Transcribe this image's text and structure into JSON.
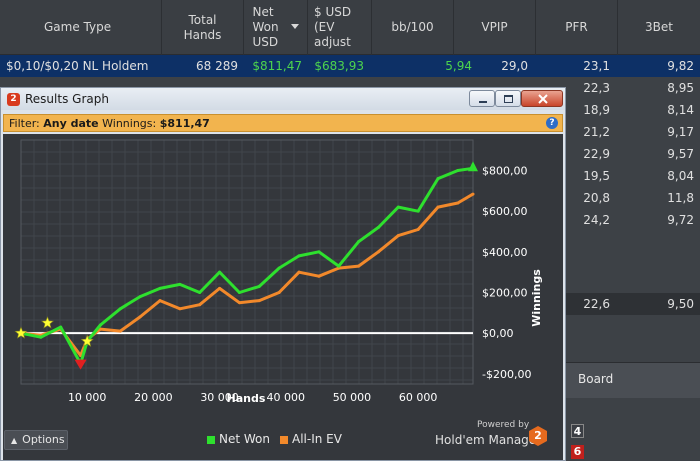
{
  "table": {
    "headers": [
      {
        "label": "Game Type"
      },
      {
        "label": "Total Hands"
      },
      {
        "label": "Net Won USD"
      },
      {
        "label": "$ USD (EV adjust"
      },
      {
        "label": "bb/100"
      },
      {
        "label": "VPIP"
      },
      {
        "label": "PFR"
      },
      {
        "label": "3Bet"
      }
    ],
    "rows": [
      {
        "game": "$0,10/$0,20 NL Holdem",
        "hands": "68 289",
        "net": "$811,47",
        "ev": "$683,93",
        "bb": "5,94",
        "vpip": "29,0",
        "pfr": "23,1",
        "threebet": "9,82"
      },
      {
        "game": "",
        "hands": "",
        "net": "",
        "ev": "",
        "bb": "",
        "vpip": "",
        "pfr": "22,3",
        "threebet": "8,95"
      },
      {
        "game": "",
        "hands": "",
        "net": "",
        "ev": "",
        "bb": "",
        "vpip": "",
        "pfr": "18,9",
        "threebet": "8,14"
      },
      {
        "game": "",
        "hands": "",
        "net": "",
        "ev": "",
        "bb": "",
        "vpip": "",
        "pfr": "21,2",
        "threebet": "9,17"
      },
      {
        "game": "",
        "hands": "",
        "net": "",
        "ev": "",
        "bb": "",
        "vpip": "",
        "pfr": "22,9",
        "threebet": "9,57"
      },
      {
        "game": "",
        "hands": "",
        "net": "",
        "ev": "",
        "bb": "",
        "vpip": "",
        "pfr": "19,5",
        "threebet": "8,04"
      },
      {
        "game": "",
        "hands": "",
        "net": "",
        "ev": "",
        "bb": "",
        "vpip": "",
        "pfr": "20,8",
        "threebet": "11,8"
      },
      {
        "game": "",
        "hands": "",
        "net": "",
        "ev": "",
        "bb": "",
        "vpip": "",
        "pfr": "24,2",
        "threebet": "9,72"
      }
    ],
    "totals": {
      "pfr": "22,6",
      "threebet": "9,50"
    },
    "board_label": "Board",
    "cards": [
      "4",
      "6"
    ]
  },
  "window": {
    "title": "Results Graph",
    "app_icon": "2",
    "filter_label": "Filter:",
    "filter_value": "Any date",
    "winnings_label": "Winnings:",
    "winnings_value": "$811,47",
    "help": "?",
    "options_label": "Options",
    "powered_by": "Powered by",
    "brand": "Hold'em Manager",
    "brand_icon": "2"
  },
  "chart_data": {
    "type": "line",
    "xlabel": "Hands",
    "ylabel": "Winnings",
    "x_ticks": [
      "10 000",
      "20 000",
      "30 000",
      "40 000",
      "50 000",
      "60 000"
    ],
    "y_ticks": [
      "$800,00",
      "$600,00",
      "$400,00",
      "$200,00",
      "$0,00",
      "-$200,00"
    ],
    "xlim": [
      0,
      68289
    ],
    "ylim": [
      -250,
      950
    ],
    "series": [
      {
        "name": "Net Won",
        "color": "#2ee02e",
        "x": [
          0,
          3000,
          6000,
          9000,
          10000,
          12000,
          15000,
          18000,
          21000,
          24000,
          27000,
          30000,
          33000,
          36000,
          39000,
          42000,
          45000,
          48000,
          51000,
          54000,
          57000,
          60000,
          63000,
          66000,
          68289
        ],
        "y": [
          0,
          -20,
          30,
          -150,
          -40,
          40,
          120,
          180,
          220,
          240,
          200,
          300,
          200,
          230,
          320,
          380,
          400,
          330,
          450,
          520,
          620,
          600,
          760,
          800,
          811
        ]
      },
      {
        "name": "All-In EV",
        "color": "#f2892b",
        "x": [
          0,
          3000,
          6000,
          9000,
          10000,
          12000,
          15000,
          18000,
          21000,
          24000,
          27000,
          30000,
          33000,
          36000,
          39000,
          42000,
          45000,
          48000,
          51000,
          54000,
          57000,
          60000,
          63000,
          66000,
          68289
        ],
        "y": [
          0,
          -10,
          20,
          -110,
          -30,
          20,
          10,
          80,
          160,
          120,
          140,
          220,
          150,
          160,
          200,
          300,
          280,
          320,
          330,
          400,
          480,
          510,
          620,
          640,
          684
        ]
      }
    ],
    "markers": [
      {
        "x": 0,
        "y": 0,
        "kind": "star",
        "color": "#ffff33"
      },
      {
        "x": 4000,
        "y": 50,
        "kind": "star",
        "color": "#ffff33"
      },
      {
        "x": 10000,
        "y": -40,
        "kind": "star",
        "color": "#ffff33"
      },
      {
        "x": 9000,
        "y": -150,
        "kind": "triangle-down",
        "color": "#e02020"
      },
      {
        "x": 68289,
        "y": 811,
        "kind": "triangle-up",
        "color": "#2ee02e"
      }
    ],
    "grid": true,
    "legend": "bottom"
  }
}
